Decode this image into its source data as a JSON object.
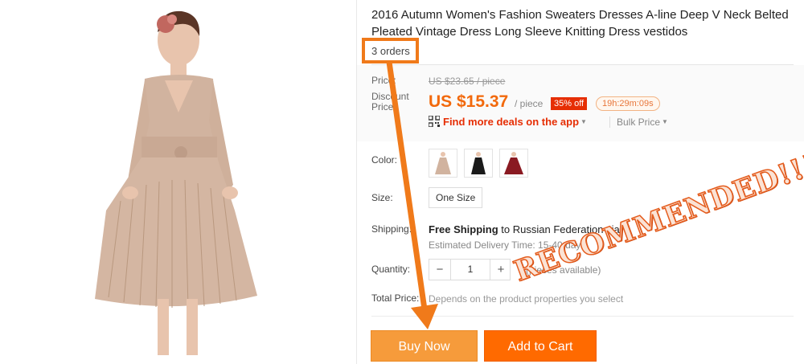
{
  "product": {
    "title": "2016 Autumn Women's Fashion Sweaters Dresses A-line Deep V Neck Belted Pleated Vintage Dress Long Sleeve Knitting Dress vestidos",
    "orders": "3 orders"
  },
  "price": {
    "label": "Price:",
    "original": "US $23.65 / piece",
    "discount_label": "Discount Price:",
    "current": "US $15.37",
    "unit": "/ piece",
    "off_badge": "35% off",
    "timer": "19h:29m:09s",
    "app_deals": "Find more deals on the app",
    "bulk": "Bulk Price"
  },
  "options": {
    "color_label": "Color:",
    "colors": [
      "beige",
      "black",
      "burgundy"
    ],
    "size_label": "Size:",
    "size_value": "One Size",
    "shipping_label": "Shipping:",
    "shipping_free": "Free Shipping",
    "shipping_to": "to Russian Federation via",
    "delivery": "Estimated Delivery Time: 15-40 days",
    "quantity_label": "Quantity:",
    "quantity_value": "1",
    "quantity_minus": "−",
    "quantity_plus": "+",
    "availability": "(pieces available)",
    "total_label": "Total Price:",
    "total_value": "Depends on the product properties you select"
  },
  "actions": {
    "buy_now": "Buy Now",
    "add_to_cart": "Add to Cart"
  },
  "annotation": {
    "stamp": "RECOMMENDED!!!",
    "accent": "#f07a1a"
  }
}
